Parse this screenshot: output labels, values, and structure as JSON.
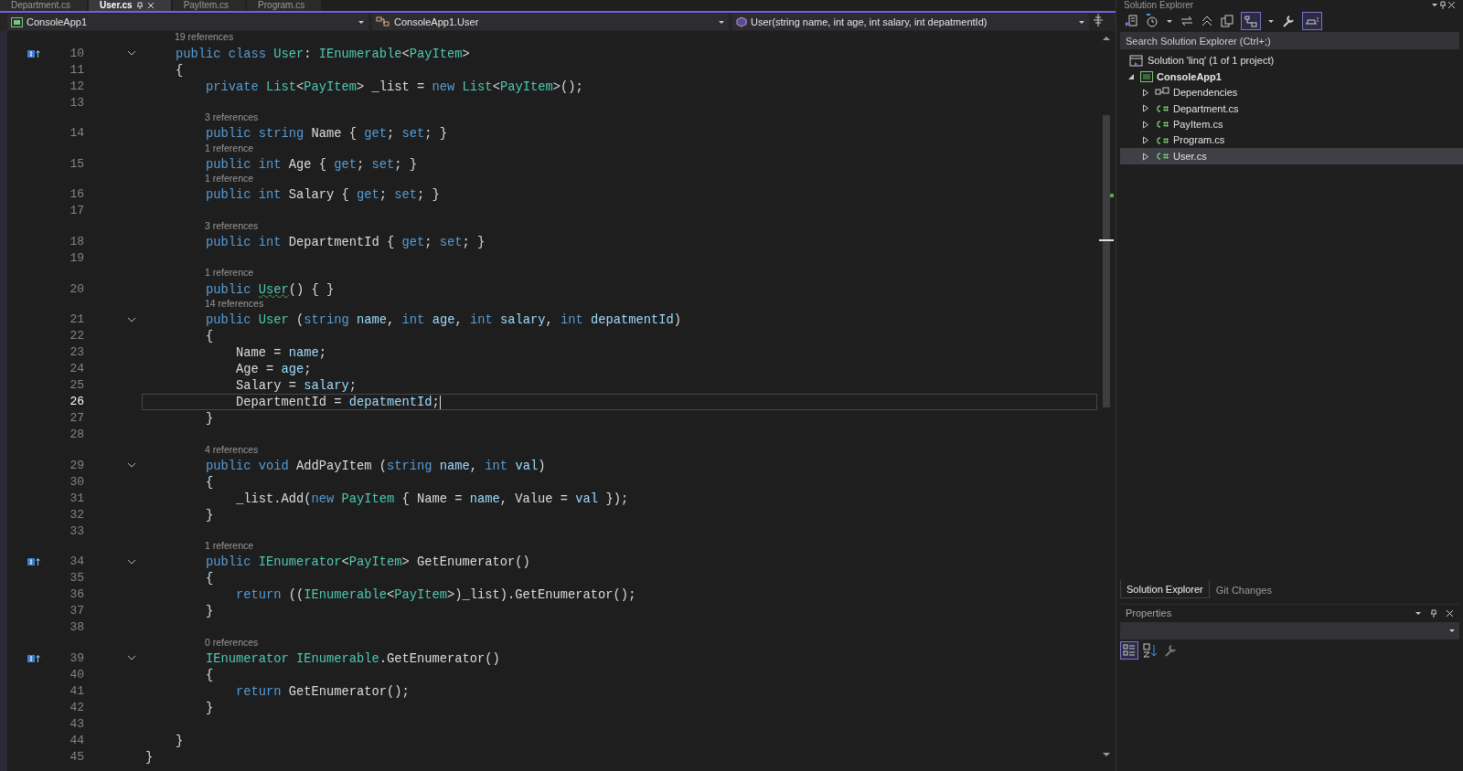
{
  "doc_tabs": [
    {
      "label": "Department.cs",
      "selected": false
    },
    {
      "label": "User.cs",
      "selected": true
    },
    {
      "label": "PayItem.cs",
      "selected": false
    },
    {
      "label": "Program.cs",
      "selected": false
    }
  ],
  "nav_bar": {
    "project": "ConsoleApp1",
    "type": "ConsoleApp1.User",
    "member": "User(string name, int age, int salary, int depatmentId)"
  },
  "editor": {
    "lines": [
      {
        "number": "10",
        "lens": "19 references",
        "marker": true,
        "foldable": true,
        "current": false,
        "tokens": [
          {
            "kind": "kw",
            "text": "    public class "
          },
          {
            "kind": "type",
            "text": "User"
          },
          {
            "kind": "plain",
            "text": ": "
          },
          {
            "kind": "type",
            "text": "IEnumerable"
          },
          {
            "kind": "plain",
            "text": "<"
          },
          {
            "kind": "type",
            "text": "PayItem"
          },
          {
            "kind": "plain",
            "text": ">"
          }
        ]
      },
      {
        "number": "11",
        "marker": false,
        "foldable": false,
        "current": false,
        "tokens": [
          {
            "kind": "plain",
            "text": "    {"
          }
        ]
      },
      {
        "number": "12",
        "marker": false,
        "foldable": false,
        "current": false,
        "tokens": [
          {
            "kind": "kw",
            "text": "        private "
          },
          {
            "kind": "type",
            "text": "List"
          },
          {
            "kind": "plain",
            "text": "<"
          },
          {
            "kind": "type",
            "text": "PayItem"
          },
          {
            "kind": "plain",
            "text": "> _list = "
          },
          {
            "kind": "kw",
            "text": "new "
          },
          {
            "kind": "type",
            "text": "List"
          },
          {
            "kind": "plain",
            "text": "<"
          },
          {
            "kind": "type",
            "text": "PayItem"
          },
          {
            "kind": "plain",
            "text": ">();"
          }
        ]
      },
      {
        "number": "13",
        "marker": false,
        "foldable": false,
        "current": false
      },
      {
        "number": "14",
        "lens": "3 references",
        "marker": false,
        "foldable": false,
        "current": false,
        "tokens": [
          {
            "kind": "kw",
            "text": "        public string "
          },
          {
            "kind": "plain",
            "text": "Name { "
          },
          {
            "kind": "kw",
            "text": "get"
          },
          {
            "kind": "plain",
            "text": "; "
          },
          {
            "kind": "kw",
            "text": "set"
          },
          {
            "kind": "plain",
            "text": "; }"
          }
        ]
      },
      {
        "number": "15",
        "lens": "1 reference",
        "marker": false,
        "foldable": false,
        "current": false,
        "tokens": [
          {
            "kind": "kw",
            "text": "        public int "
          },
          {
            "kind": "plain",
            "text": "Age { "
          },
          {
            "kind": "kw",
            "text": "get"
          },
          {
            "kind": "plain",
            "text": "; "
          },
          {
            "kind": "kw",
            "text": "set"
          },
          {
            "kind": "plain",
            "text": "; }"
          }
        ]
      },
      {
        "number": "16",
        "lens": "1 reference",
        "marker": false,
        "foldable": false,
        "current": false,
        "tokens": [
          {
            "kind": "kw",
            "text": "        public int "
          },
          {
            "kind": "plain",
            "text": "Salary { "
          },
          {
            "kind": "kw",
            "text": "get"
          },
          {
            "kind": "plain",
            "text": "; "
          },
          {
            "kind": "kw",
            "text": "set"
          },
          {
            "kind": "plain",
            "text": "; }"
          }
        ]
      },
      {
        "number": "17",
        "marker": false,
        "foldable": false,
        "current": false
      },
      {
        "number": "18",
        "lens": "3 references",
        "marker": false,
        "foldable": false,
        "current": false,
        "tokens": [
          {
            "kind": "kw",
            "text": "        public int "
          },
          {
            "kind": "plain",
            "text": "DepartmentId { "
          },
          {
            "kind": "kw",
            "text": "get"
          },
          {
            "kind": "plain",
            "text": "; "
          },
          {
            "kind": "kw",
            "text": "set"
          },
          {
            "kind": "plain",
            "text": "; }"
          }
        ]
      },
      {
        "number": "19",
        "marker": false,
        "foldable": false,
        "current": false
      },
      {
        "number": "20",
        "lens": "1 reference",
        "marker": false,
        "foldable": false,
        "current": false,
        "tokens": [
          {
            "kind": "kw",
            "text": "        public "
          },
          {
            "kind": "warn",
            "text": "User"
          },
          {
            "kind": "plain",
            "text": "() { }"
          }
        ]
      },
      {
        "number": "21",
        "lens": "14 references",
        "marker": false,
        "foldable": true,
        "current": false,
        "tokens": [
          {
            "kind": "kw",
            "text": "        public "
          },
          {
            "kind": "type",
            "text": "User"
          },
          {
            "kind": "plain",
            "text": " ("
          },
          {
            "kind": "kw",
            "text": "string "
          },
          {
            "kind": "param",
            "text": "name"
          },
          {
            "kind": "plain",
            "text": ", "
          },
          {
            "kind": "kw",
            "text": "int "
          },
          {
            "kind": "param",
            "text": "age"
          },
          {
            "kind": "plain",
            "text": ", "
          },
          {
            "kind": "kw",
            "text": "int "
          },
          {
            "kind": "param",
            "text": "salary"
          },
          {
            "kind": "plain",
            "text": ", "
          },
          {
            "kind": "kw",
            "text": "int "
          },
          {
            "kind": "param",
            "text": "depatmentId"
          },
          {
            "kind": "plain",
            "text": ")"
          }
        ]
      },
      {
        "number": "22",
        "marker": false,
        "foldable": false,
        "current": false,
        "tokens": [
          {
            "kind": "plain",
            "text": "        {"
          }
        ]
      },
      {
        "number": "23",
        "marker": false,
        "foldable": false,
        "current": false,
        "tokens": [
          {
            "kind": "plain",
            "text": "            Name = "
          },
          {
            "kind": "param",
            "text": "name"
          },
          {
            "kind": "plain",
            "text": ";"
          }
        ]
      },
      {
        "number": "24",
        "marker": false,
        "foldable": false,
        "current": false,
        "tokens": [
          {
            "kind": "plain",
            "text": "            Age = "
          },
          {
            "kind": "param",
            "text": "age"
          },
          {
            "kind": "plain",
            "text": ";"
          }
        ]
      },
      {
        "number": "25",
        "marker": false,
        "foldable": false,
        "current": false,
        "tokens": [
          {
            "kind": "plain",
            "text": "            Salary = "
          },
          {
            "kind": "param",
            "text": "salary"
          },
          {
            "kind": "plain",
            "text": ";"
          }
        ]
      },
      {
        "number": "26",
        "marker": false,
        "foldable": false,
        "current": true,
        "tokens": [
          {
            "kind": "plain",
            "text": "            DepartmentId = "
          },
          {
            "kind": "param",
            "text": "depatmentId"
          },
          {
            "kind": "plain",
            "text": ";"
          }
        ]
      },
      {
        "number": "27",
        "marker": false,
        "foldable": false,
        "current": false,
        "tokens": [
          {
            "kind": "plain",
            "text": "        }"
          }
        ]
      },
      {
        "number": "28",
        "marker": false,
        "foldable": false,
        "current": false
      },
      {
        "number": "29",
        "lens": "4 references",
        "marker": false,
        "foldable": true,
        "current": false,
        "tokens": [
          {
            "kind": "kw",
            "text": "        public void "
          },
          {
            "kind": "plain",
            "text": "AddPayItem ("
          },
          {
            "kind": "kw",
            "text": "string "
          },
          {
            "kind": "param",
            "text": "name"
          },
          {
            "kind": "plain",
            "text": ", "
          },
          {
            "kind": "kw",
            "text": "int "
          },
          {
            "kind": "param",
            "text": "val"
          },
          {
            "kind": "plain",
            "text": ")"
          }
        ]
      },
      {
        "number": "30",
        "marker": false,
        "foldable": false,
        "current": false,
        "tokens": [
          {
            "kind": "plain",
            "text": "        {"
          }
        ]
      },
      {
        "number": "31",
        "marker": false,
        "foldable": false,
        "current": false,
        "tokens": [
          {
            "kind": "plain",
            "text": "            _list.Add("
          },
          {
            "kind": "kw",
            "text": "new "
          },
          {
            "kind": "type",
            "text": "PayItem"
          },
          {
            "kind": "plain",
            "text": " { Name = "
          },
          {
            "kind": "param",
            "text": "name"
          },
          {
            "kind": "plain",
            "text": ", Value = "
          },
          {
            "kind": "param",
            "text": "val"
          },
          {
            "kind": "plain",
            "text": " });"
          }
        ]
      },
      {
        "number": "32",
        "marker": false,
        "foldable": false,
        "current": false,
        "tokens": [
          {
            "kind": "plain",
            "text": "        }"
          }
        ]
      },
      {
        "number": "33",
        "marker": false,
        "foldable": false,
        "current": false
      },
      {
        "number": "34",
        "lens": "1 reference",
        "marker": true,
        "foldable": true,
        "current": false,
        "tokens": [
          {
            "kind": "kw",
            "text": "        public "
          },
          {
            "kind": "type",
            "text": "IEnumerator"
          },
          {
            "kind": "plain",
            "text": "<"
          },
          {
            "kind": "type",
            "text": "PayItem"
          },
          {
            "kind": "plain",
            "text": "> GetEnumerator()"
          }
        ]
      },
      {
        "number": "35",
        "marker": false,
        "foldable": false,
        "current": false,
        "tokens": [
          {
            "kind": "plain",
            "text": "        {"
          }
        ]
      },
      {
        "number": "36",
        "marker": false,
        "foldable": false,
        "current": false,
        "tokens": [
          {
            "kind": "kw",
            "text": "            return "
          },
          {
            "kind": "plain",
            "text": "(("
          },
          {
            "kind": "type",
            "text": "IEnumerable"
          },
          {
            "kind": "plain",
            "text": "<"
          },
          {
            "kind": "type",
            "text": "PayItem"
          },
          {
            "kind": "plain",
            "text": ">)_list).GetEnumerator();"
          }
        ]
      },
      {
        "number": "37",
        "marker": false,
        "foldable": false,
        "current": false,
        "tokens": [
          {
            "kind": "plain",
            "text": "        }"
          }
        ]
      },
      {
        "number": "38",
        "marker": false,
        "foldable": false,
        "current": false
      },
      {
        "number": "39",
        "lens": "0 references",
        "marker": true,
        "foldable": true,
        "current": false,
        "tokens": [
          {
            "kind": "type",
            "text": "        IEnumerator IEnumerable"
          },
          {
            "kind": "plain",
            "text": ".GetEnumerator()"
          }
        ]
      },
      {
        "number": "40",
        "marker": false,
        "foldable": false,
        "current": false,
        "tokens": [
          {
            "kind": "plain",
            "text": "        {"
          }
        ]
      },
      {
        "number": "41",
        "marker": false,
        "foldable": false,
        "current": false,
        "tokens": [
          {
            "kind": "kw",
            "text": "            return "
          },
          {
            "kind": "plain",
            "text": "GetEnumerator();"
          }
        ]
      },
      {
        "number": "42",
        "marker": false,
        "foldable": false,
        "current": false,
        "tokens": [
          {
            "kind": "plain",
            "text": "        }"
          }
        ]
      },
      {
        "number": "43",
        "marker": false,
        "foldable": false,
        "current": false
      },
      {
        "number": "44",
        "marker": false,
        "foldable": false,
        "current": false,
        "tokens": [
          {
            "kind": "plain",
            "text": "    }"
          }
        ]
      },
      {
        "number": "45",
        "marker": false,
        "foldable": false,
        "current": false,
        "tokens": [
          {
            "kind": "plain",
            "text": "}"
          }
        ]
      }
    ]
  },
  "solution_explorer": {
    "title": "Solution Explorer",
    "search": {
      "placeholder": "Search Solution Explorer (Ctrl+;)"
    },
    "tree": [
      {
        "label": "Solution 'linq' (1 of 1 project)",
        "kind": "solution",
        "selected": false,
        "children": [
          {
            "label": "ConsoleApp1",
            "kind": "project",
            "expanded": true,
            "selected": false,
            "children": [
              {
                "label": "Dependencies",
                "kind": "dependencies",
                "expanded": false,
                "selected": false
              },
              {
                "label": "Department.cs",
                "kind": "csharp",
                "expanded": false,
                "selected": false
              },
              {
                "label": "PayItem.cs",
                "kind": "csharp",
                "expanded": false,
                "selected": false
              },
              {
                "label": "Program.cs",
                "kind": "csharp",
                "expanded": false,
                "selected": false
              },
              {
                "label": "User.cs",
                "kind": "csharp",
                "expanded": false,
                "selected": true
              }
            ]
          }
        ]
      }
    ]
  },
  "panel_tabs": [
    {
      "label": "Solution Explorer",
      "selected": true
    },
    {
      "label": "Git Changes",
      "selected": false
    }
  ],
  "properties": {
    "title": "Properties"
  }
}
